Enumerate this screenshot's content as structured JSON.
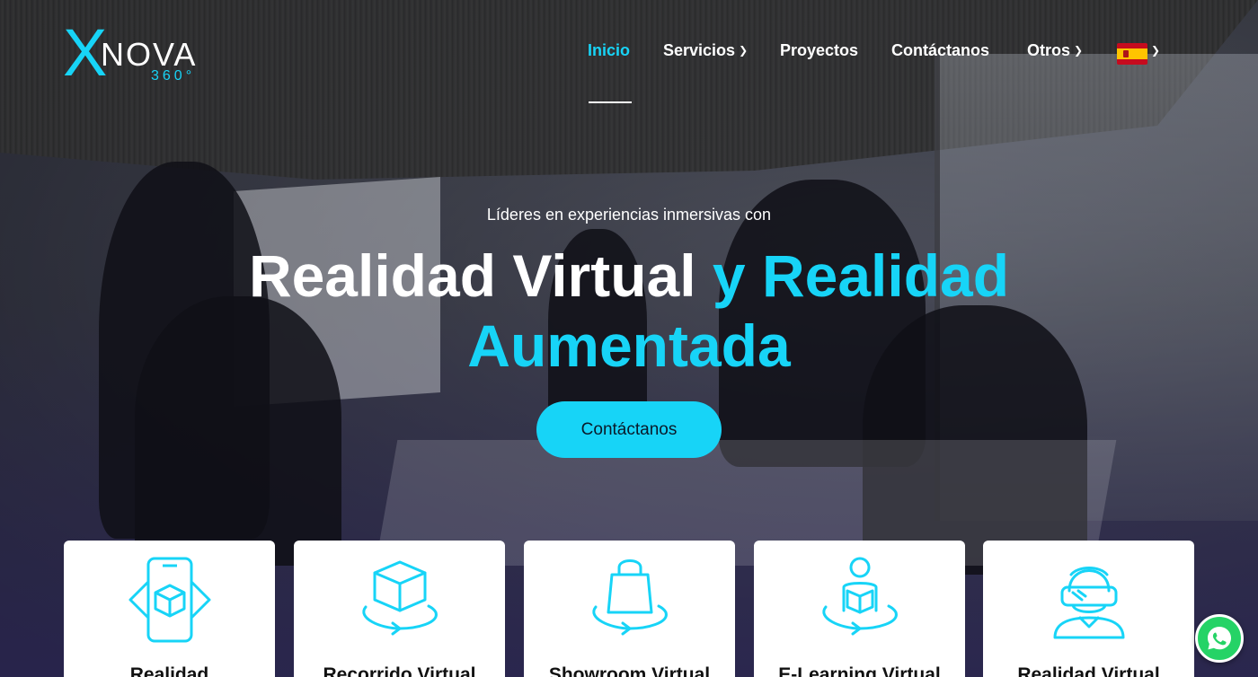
{
  "brand": {
    "logo_x": "X",
    "logo_nova": "NOVA",
    "logo_360": "360°"
  },
  "nav": {
    "items": [
      {
        "label": "Inicio",
        "active": true
      },
      {
        "label": "Servicios",
        "dropdown": true
      },
      {
        "label": "Proyectos"
      },
      {
        "label": "Contáctanos"
      },
      {
        "label": "Otros",
        "dropdown": true
      }
    ],
    "language_flag": "spain-flag-icon"
  },
  "hero": {
    "tagline": "Líderes en experiencias inmersivas con",
    "headline_white": "Realidad Virtual",
    "headline_accent_1": "y Realidad",
    "headline_accent_2": "Aumentada",
    "cta_label": "Contáctanos"
  },
  "cards": [
    {
      "title": "Realidad",
      "icon": "ar-phone-icon"
    },
    {
      "title": "Recorrido Virtual",
      "icon": "cube-360-icon"
    },
    {
      "title": "Showroom Virtual",
      "icon": "shopping-bag-360-icon"
    },
    {
      "title": "E-Learning Virtual",
      "icon": "student-reading-360-icon"
    },
    {
      "title": "Realidad Virtual",
      "icon": "vr-headset-user-icon"
    }
  ],
  "colors": {
    "accent": "#17d4f7",
    "whatsapp": "#25d366"
  }
}
